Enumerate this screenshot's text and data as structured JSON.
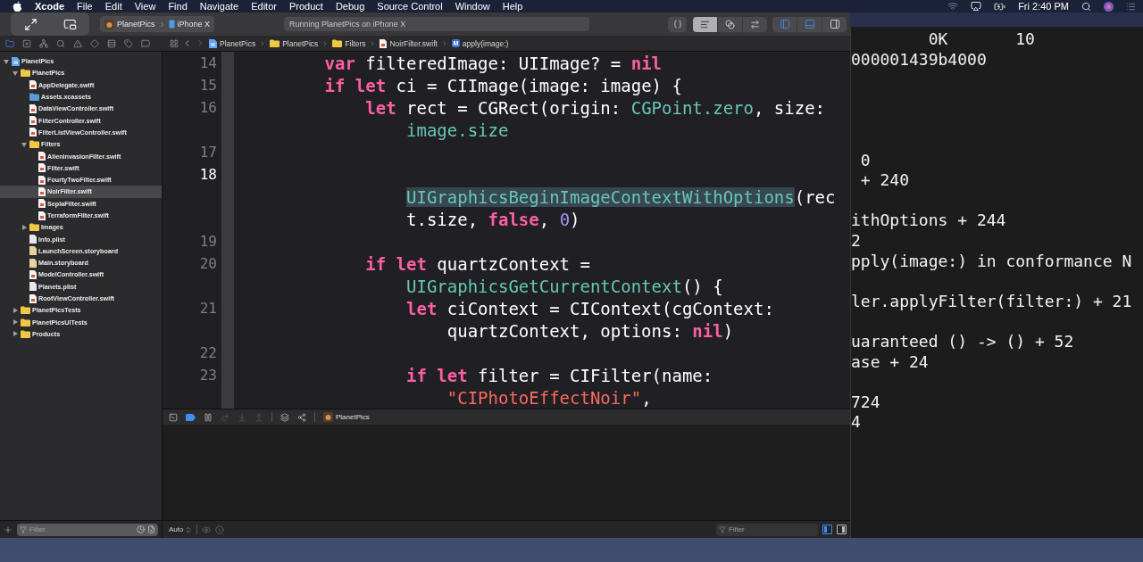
{
  "menu_bar": {
    "app": "Xcode",
    "items": [
      "File",
      "Edit",
      "View",
      "Find",
      "Navigate",
      "Editor",
      "Product",
      "Debug",
      "Source Control",
      "Window",
      "Help"
    ],
    "clock": "Fri 2:40 PM"
  },
  "toolbar": {
    "scheme": "PlanetPics",
    "device": "iPhone X",
    "activity": "Running PlanetPics on iPhone X",
    "editor_modes": [
      {
        "kind": "standard",
        "selected": true
      },
      {
        "kind": "assistant",
        "selected": false
      },
      {
        "kind": "version",
        "selected": false
      }
    ],
    "panels": [
      {
        "kind": "navigator",
        "on": true
      },
      {
        "kind": "debug",
        "on": true
      },
      {
        "kind": "inspector",
        "on": false
      }
    ]
  },
  "navigator_tabs": [
    {
      "kind": "project",
      "selected": true
    },
    {
      "kind": "source_control",
      "selected": false
    },
    {
      "kind": "symbol",
      "selected": false
    },
    {
      "kind": "find",
      "selected": false
    },
    {
      "kind": "issue",
      "selected": false
    },
    {
      "kind": "test",
      "selected": false
    },
    {
      "kind": "debug",
      "selected": false
    },
    {
      "kind": "breakpoint",
      "selected": false
    },
    {
      "kind": "report",
      "selected": false
    }
  ],
  "jump_bar": [
    {
      "kind": "project",
      "label": "PlanetPics"
    },
    {
      "kind": "folder",
      "label": "PlanetPics"
    },
    {
      "kind": "folder",
      "label": "Filters"
    },
    {
      "kind": "swift",
      "label": "NoirFilter.swift"
    },
    {
      "kind": "method",
      "badge": "M",
      "label": "apply(image:)"
    }
  ],
  "navigator": {
    "filter_placeholder": "Filter",
    "tree": [
      {
        "name": "PlanetPics",
        "kind": "project",
        "expanded": true,
        "selected": false,
        "children": [
          {
            "name": "PlanetPics",
            "kind": "folder",
            "expanded": true,
            "selected": false,
            "children": [
              {
                "name": "AppDelegate.swift",
                "kind": "swift",
                "selected": false
              },
              {
                "name": "Assets.xcassets",
                "kind": "assets",
                "selected": false
              },
              {
                "name": "DataViewController.swift",
                "kind": "swift",
                "selected": false
              },
              {
                "name": "FilterController.swift",
                "kind": "swift",
                "selected": false
              },
              {
                "name": "FilterListViewController.swift",
                "kind": "swift",
                "selected": false
              },
              {
                "name": "Filters",
                "kind": "folder",
                "expanded": true,
                "selected": false,
                "children": [
                  {
                    "name": "AlienInvasionFilter.swift",
                    "kind": "swift",
                    "selected": false
                  },
                  {
                    "name": "Filter.swift",
                    "kind": "swift",
                    "selected": false
                  },
                  {
                    "name": "FourtyTwoFilter.swift",
                    "kind": "swift",
                    "selected": false
                  },
                  {
                    "name": "NoirFilter.swift",
                    "kind": "swift",
                    "selected": true
                  },
                  {
                    "name": "SepiaFilter.swift",
                    "kind": "swift",
                    "selected": false
                  },
                  {
                    "name": "TerraformFilter.swift",
                    "kind": "swift",
                    "selected": false
                  }
                ]
              },
              {
                "name": "Images",
                "kind": "folder",
                "expanded": false,
                "selected": false
              },
              {
                "name": "Info.plist",
                "kind": "plist",
                "selected": false
              },
              {
                "name": "LaunchScreen.storyboard",
                "kind": "storyboard",
                "selected": false
              },
              {
                "name": "Main.storyboard",
                "kind": "storyboard",
                "selected": false
              },
              {
                "name": "ModelController.swift",
                "kind": "swift",
                "selected": false
              },
              {
                "name": "Planets.plist",
                "kind": "plist",
                "selected": false
              },
              {
                "name": "RootViewController.swift",
                "kind": "swift",
                "selected": false
              }
            ]
          },
          {
            "name": "PlanetPicsTests",
            "kind": "folder",
            "expanded": false,
            "selected": false
          },
          {
            "name": "PlanetPicsUITests",
            "kind": "folder",
            "expanded": false,
            "selected": false
          },
          {
            "name": "Products",
            "kind": "folder",
            "expanded": false,
            "selected": false
          }
        ]
      }
    ]
  },
  "editor": {
    "rows": [
      {
        "number": "14",
        "current": false,
        "tokens": [
          {
            "kind": "kw",
            "text": "        var"
          },
          {
            "kind": "plain",
            "text": " filteredImage: UIImage? = "
          },
          {
            "kind": "kw",
            "text": "nil"
          }
        ]
      },
      {
        "number": "15",
        "current": false,
        "tokens": [
          {
            "kind": "kw",
            "text": "        if let"
          },
          {
            "kind": "plain",
            "text": " ci = CIImage(image: image) {"
          }
        ]
      },
      {
        "number": "16",
        "current": false,
        "tokens": [
          {
            "kind": "kw",
            "text": "            let"
          },
          {
            "kind": "plain",
            "text": " rect = CGRect(origin: "
          },
          {
            "kind": "api",
            "text": "CGPoint.zero"
          },
          {
            "kind": "plain",
            "text": ", size:"
          }
        ]
      },
      {
        "tokens": [
          {
            "kind": "api",
            "text": "                image.size"
          }
        ]
      },
      {
        "number": "17",
        "current": false
      },
      {
        "number": "18",
        "current": true
      },
      {
        "tokens": [
          {
            "kind": "api",
            "text": "                UIGraphicsBeginImageContextWithOptions",
            "highlighted": true
          },
          {
            "kind": "plain",
            "text": "(rec"
          }
        ]
      },
      {
        "tokens": [
          {
            "kind": "plain",
            "text": "                t.size, "
          },
          {
            "kind": "kw",
            "text": "false"
          },
          {
            "kind": "plain",
            "text": ", "
          },
          {
            "kind": "num",
            "text": "0"
          },
          {
            "kind": "plain",
            "text": ")"
          }
        ]
      },
      {
        "number": "19",
        "current": false
      },
      {
        "number": "20",
        "current": false,
        "tokens": [
          {
            "kind": "kw",
            "text": "            if let"
          },
          {
            "kind": "plain",
            "text": " quartzContext ="
          }
        ]
      },
      {
        "tokens": [
          {
            "kind": "api",
            "text": "                UIGraphicsGetCurrentContext"
          },
          {
            "kind": "plain",
            "text": "() {"
          }
        ]
      },
      {
        "number": "21",
        "current": false,
        "tokens": [
          {
            "kind": "kw",
            "text": "                let"
          },
          {
            "kind": "plain",
            "text": " ciContext = CIContext(cgContext:"
          }
        ]
      },
      {
        "tokens": [
          {
            "kind": "plain",
            "text": "                    quartzContext, options: "
          },
          {
            "kind": "kw",
            "text": "nil"
          },
          {
            "kind": "plain",
            "text": ")"
          }
        ]
      },
      {
        "number": "22",
        "current": false
      },
      {
        "number": "23",
        "current": false,
        "tokens": [
          {
            "kind": "kw",
            "text": "                if let"
          },
          {
            "kind": "plain",
            "text": " filter = CIFilter(name:"
          }
        ]
      },
      {
        "tokens": [
          {
            "kind": "str",
            "text": "                    \"CIPhotoEffectNoir\""
          },
          {
            "kind": "plain",
            "text": ","
          }
        ]
      }
    ]
  },
  "debug_bar": {
    "breakpoints_active": true,
    "target": "PlanetPics"
  },
  "console": {
    "mode": "Auto",
    "filter_placeholder": "Filter",
    "panes": [
      {
        "kind": "variables",
        "on": true
      },
      {
        "kind": "console",
        "on": false
      }
    ]
  },
  "terminal": {
    "lines": [
      {
        "kind": "text",
        "text": "        0K       10"
      },
      {
        "kind": "text",
        "text": "000001439b4000"
      },
      {
        "kind": "blank"
      },
      {
        "kind": "blank"
      },
      {
        "kind": "blank"
      },
      {
        "kind": "blank"
      },
      {
        "kind": "text",
        "text": " 0"
      },
      {
        "kind": "text",
        "text": " + 240"
      },
      {
        "kind": "blank"
      },
      {
        "kind": "text",
        "text": "ithOptions + 244"
      },
      {
        "kind": "text",
        "text": "2"
      },
      {
        "kind": "text",
        "text": "pply(image:) in conformance N"
      },
      {
        "kind": "blank"
      },
      {
        "kind": "text",
        "text": "ler.applyFilter(filter:) + 21"
      },
      {
        "kind": "blank"
      },
      {
        "kind": "text",
        "text": "uaranteed () -> () + 52"
      },
      {
        "kind": "text",
        "text": "ase + 24"
      },
      {
        "kind": "blank"
      },
      {
        "kind": "text",
        "text": "724"
      },
      {
        "kind": "text",
        "text": "4"
      }
    ]
  }
}
